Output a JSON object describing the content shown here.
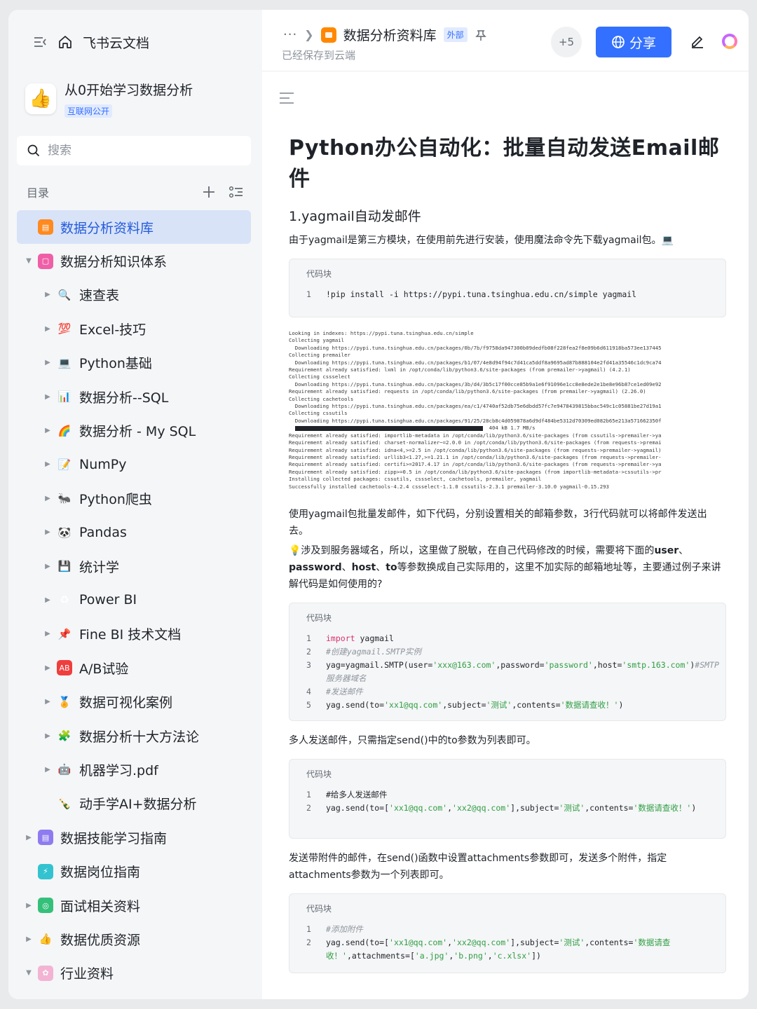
{
  "sidebar": {
    "brand": "飞书云文档",
    "space": {
      "title": "从0开始学习数据分析",
      "badge": "互联网公开",
      "logo_emoji": "👍"
    },
    "search_placeholder": "搜索",
    "toc_label": "目录",
    "items": [
      {
        "label": "数据分析资料库",
        "level": 0,
        "arrow": "",
        "icon": "doc-orange",
        "active": true
      },
      {
        "label": "数据分析知识体系",
        "level": 0,
        "arrow": "▼",
        "icon": "doc-pink"
      },
      {
        "label": "速查表",
        "level": 1,
        "arrow": "▶",
        "icon": "magnifier-emoji"
      },
      {
        "label": "Excel-技巧",
        "level": 1,
        "arrow": "▶",
        "icon": "hundred-emoji"
      },
      {
        "label": "Python基础",
        "level": 1,
        "arrow": "▶",
        "icon": "laptop-emoji"
      },
      {
        "label": "数据分析--SQL",
        "level": 1,
        "arrow": "▶",
        "icon": "bar-chart-emoji"
      },
      {
        "label": "数据分析 - My SQL",
        "level": 1,
        "arrow": "▶",
        "icon": "rainbow-emoji"
      },
      {
        "label": "NumPy",
        "level": 1,
        "arrow": "▶",
        "icon": "memo-emoji"
      },
      {
        "label": "Python爬虫",
        "level": 1,
        "arrow": "▶",
        "icon": "ant-emoji"
      },
      {
        "label": "Pandas",
        "level": 1,
        "arrow": "▶",
        "icon": "panda-emoji"
      },
      {
        "label": "统计学",
        "level": 1,
        "arrow": "▶",
        "icon": "floppy-emoji"
      },
      {
        "label": "Power BI",
        "level": 1,
        "arrow": "▶",
        "icon": "recycle-emoji"
      },
      {
        "label": "Fine BI 技术文档",
        "level": 1,
        "arrow": "▶",
        "icon": "pushpin-emoji"
      },
      {
        "label": "A/B试验",
        "level": 1,
        "arrow": "▶",
        "icon": "ab-emoji"
      },
      {
        "label": "数据可视化案例",
        "level": 1,
        "arrow": "▶",
        "icon": "medal-emoji"
      },
      {
        "label": "数据分析十大方法论",
        "level": 1,
        "arrow": "▶",
        "icon": "puzzle-emoji"
      },
      {
        "label": "机器学习.pdf",
        "level": 1,
        "arrow": "▶",
        "icon": "robot-emoji"
      },
      {
        "label": "动手学AI+数据分析",
        "level": 1,
        "arrow": "",
        "icon": "bottle-emoji"
      },
      {
        "label": "数据技能学习指南",
        "level": 0,
        "arrow": "▶",
        "icon": "doc-purple"
      },
      {
        "label": "数据岗位指南",
        "level": 0,
        "arrow": "",
        "icon": "doc-teal"
      },
      {
        "label": "面试相关资料",
        "level": 0,
        "arrow": "▶",
        "icon": "doc-green"
      },
      {
        "label": "数据优质资源",
        "level": 0,
        "arrow": "▶",
        "icon": "thumb-emoji"
      },
      {
        "label": "行业资料",
        "level": 0,
        "arrow": "▼",
        "icon": "doc-pink-light"
      }
    ]
  },
  "header": {
    "more": "···",
    "breadcrumb": "数据分析资料库",
    "external_badge": "外部",
    "saved_status": "已经保存到云端",
    "collaborators": "+5",
    "share_label": "分享"
  },
  "doc": {
    "title": "Python办公自动化：批量自动发送Email邮件",
    "section1": "1.yagmail自动发邮件",
    "p1": "由于yagmail是第三方模块，在使用前先进行安装，使用魔法命令先下载yagmail包。💻",
    "code_caption": "代码块",
    "code1": "!pip install -i https://pypi.tuna.tsinghua.edu.cn/simple yagmail",
    "log": [
      "Looking in indexes: https://pypi.tuna.tsinghua.edu.cn/simple",
      "Collecting yagmail",
      "  Downloading https://pypi.tuna.tsinghua.edu.cn/packages/0b/7b/f9758da947300b09dedfb08f228fea2f8e09b6d611918ba573ee137445",
      "Collecting premailer",
      "  Downloading https://pypi.tuna.tsinghua.edu.cn/packages/b1/07/4e8d94f94c7d41ca5ddf8a9695ad87b888104e2fd41a35546c1dc9ca74",
      "Requirement already satisfied: lxml in /opt/conda/lib/python3.6/site-packages (from premailer->yagmail) (4.2.1)",
      "Collecting cssselect",
      "  Downloading https://pypi.tuna.tsinghua.edu.cn/packages/3b/d4/3b5c17f00cce85b9a1e6f91096e1cc8e8ede2e1be8e96b87ce1ed09e92",
      "Requirement already satisfied: requests in /opt/conda/lib/python3.6/site-packages (from premailer->yagmail) (2.26.0)",
      "Collecting cachetools",
      "  Downloading https://pypi.tuna.tsinghua.edu.cn/packages/ea/c1/4740af52db75e6dbdd57fc7e9478439815bbac549c1c05881be27d19a1",
      "Collecting cssutils",
      "  Downloading https://pypi.tuna.tsinghua.edu.cn/packages/91/25/28cb8c4d059878a6d9df484be5312d70309ed082b65e213a571662350f",
      "  404 kB 1.7 MB/s",
      "Requirement already satisfied: importlib-metadata in /opt/conda/lib/python3.6/site-packages (from cssutils->premailer->ya",
      "Requirement already satisfied: charset-normalizer~=2.0.0 in /opt/conda/lib/python3.6/site-packages (from requests->premai",
      "Requirement already satisfied: idna<4,>=2.5 in /opt/conda/lib/python3.6/site-packages (from requests->premailer->yagmail)",
      "Requirement already satisfied: urllib3<1.27,>=1.21.1 in /opt/conda/lib/python3.6/site-packages (from requests->premailer-",
      "Requirement already satisfied: certifi>=2017.4.17 in /opt/conda/lib/python3.6/site-packages (from requests->premailer->ya",
      "Requirement already satisfied: zipp>=0.5 in /opt/conda/lib/python3.6/site-packages (from importlib-metadata->cssutils->pr",
      "Installing collected packages: cssutils, cssselect, cachetools, premailer, yagmail",
      "Successfully installed cachetools-4.2.4 cssselect-1.1.0 cssutils-2.3.1 premailer-3.10.0 yagmail-0.15.293"
    ],
    "p2": "使用yagmail包批量发邮件，如下代码，分别设置相关的邮箱参数，3行代码就可以将邮件发送出去。",
    "p3_prefix": "💡涉及到服务器域名，所以，这里做了脱敏，在自己代码修改的时候，需要将下面的",
    "p3_bold1": "user",
    "p3_sep1": "、",
    "p3_bold2": "password",
    "p3_sep2": "、",
    "p3_bold3": "host",
    "p3_sep3": "、",
    "p3_bold4": "to",
    "p3_suffix": "等参数换成自己实际用的，这里不加实际的邮箱地址等，主要通过例子来讲解代码是如何使用的?",
    "p4": "多人发送邮件，只需指定send()中的to参数为列表即可。",
    "p5": "发送带附件的邮件，在send()函数中设置attachments参数即可，发送多个附件，指定attachments参数为一个列表即可。"
  }
}
